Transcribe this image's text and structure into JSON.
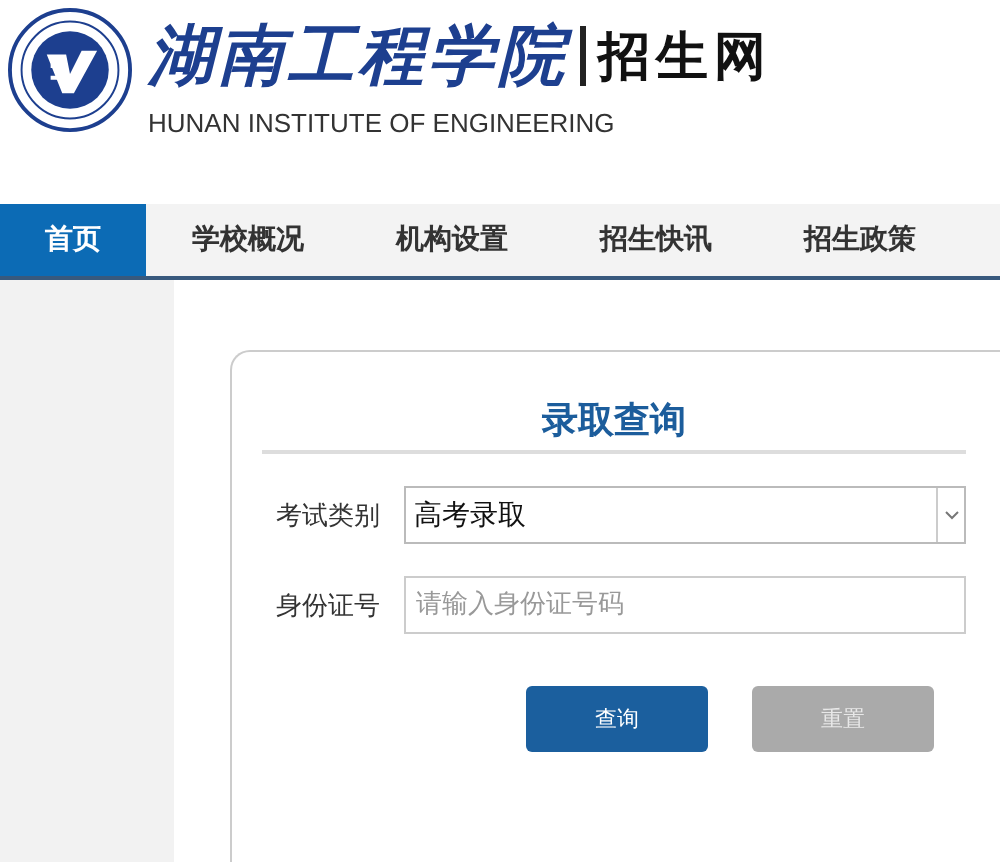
{
  "header": {
    "school_name": "湖南工程学院",
    "site_name": "招生网",
    "english_name": "HUNAN INSTITUTE OF ENGINEERING"
  },
  "nav": [
    {
      "label": "首页",
      "selected": true
    },
    {
      "label": "学校概况",
      "selected": false
    },
    {
      "label": "机构设置",
      "selected": false
    },
    {
      "label": "招生快讯",
      "selected": false
    },
    {
      "label": "招生政策",
      "selected": false
    }
  ],
  "form": {
    "title": "录取查询",
    "fields": [
      {
        "kind": "select",
        "label": "考试类别",
        "value": "高考录取"
      },
      {
        "kind": "input",
        "label": "身份证号",
        "placeholder": "请输入身份证号码"
      }
    ],
    "buttons": [
      {
        "label": "查询",
        "kind": "primary"
      },
      {
        "label": "重置",
        "kind": "secondary"
      }
    ]
  }
}
